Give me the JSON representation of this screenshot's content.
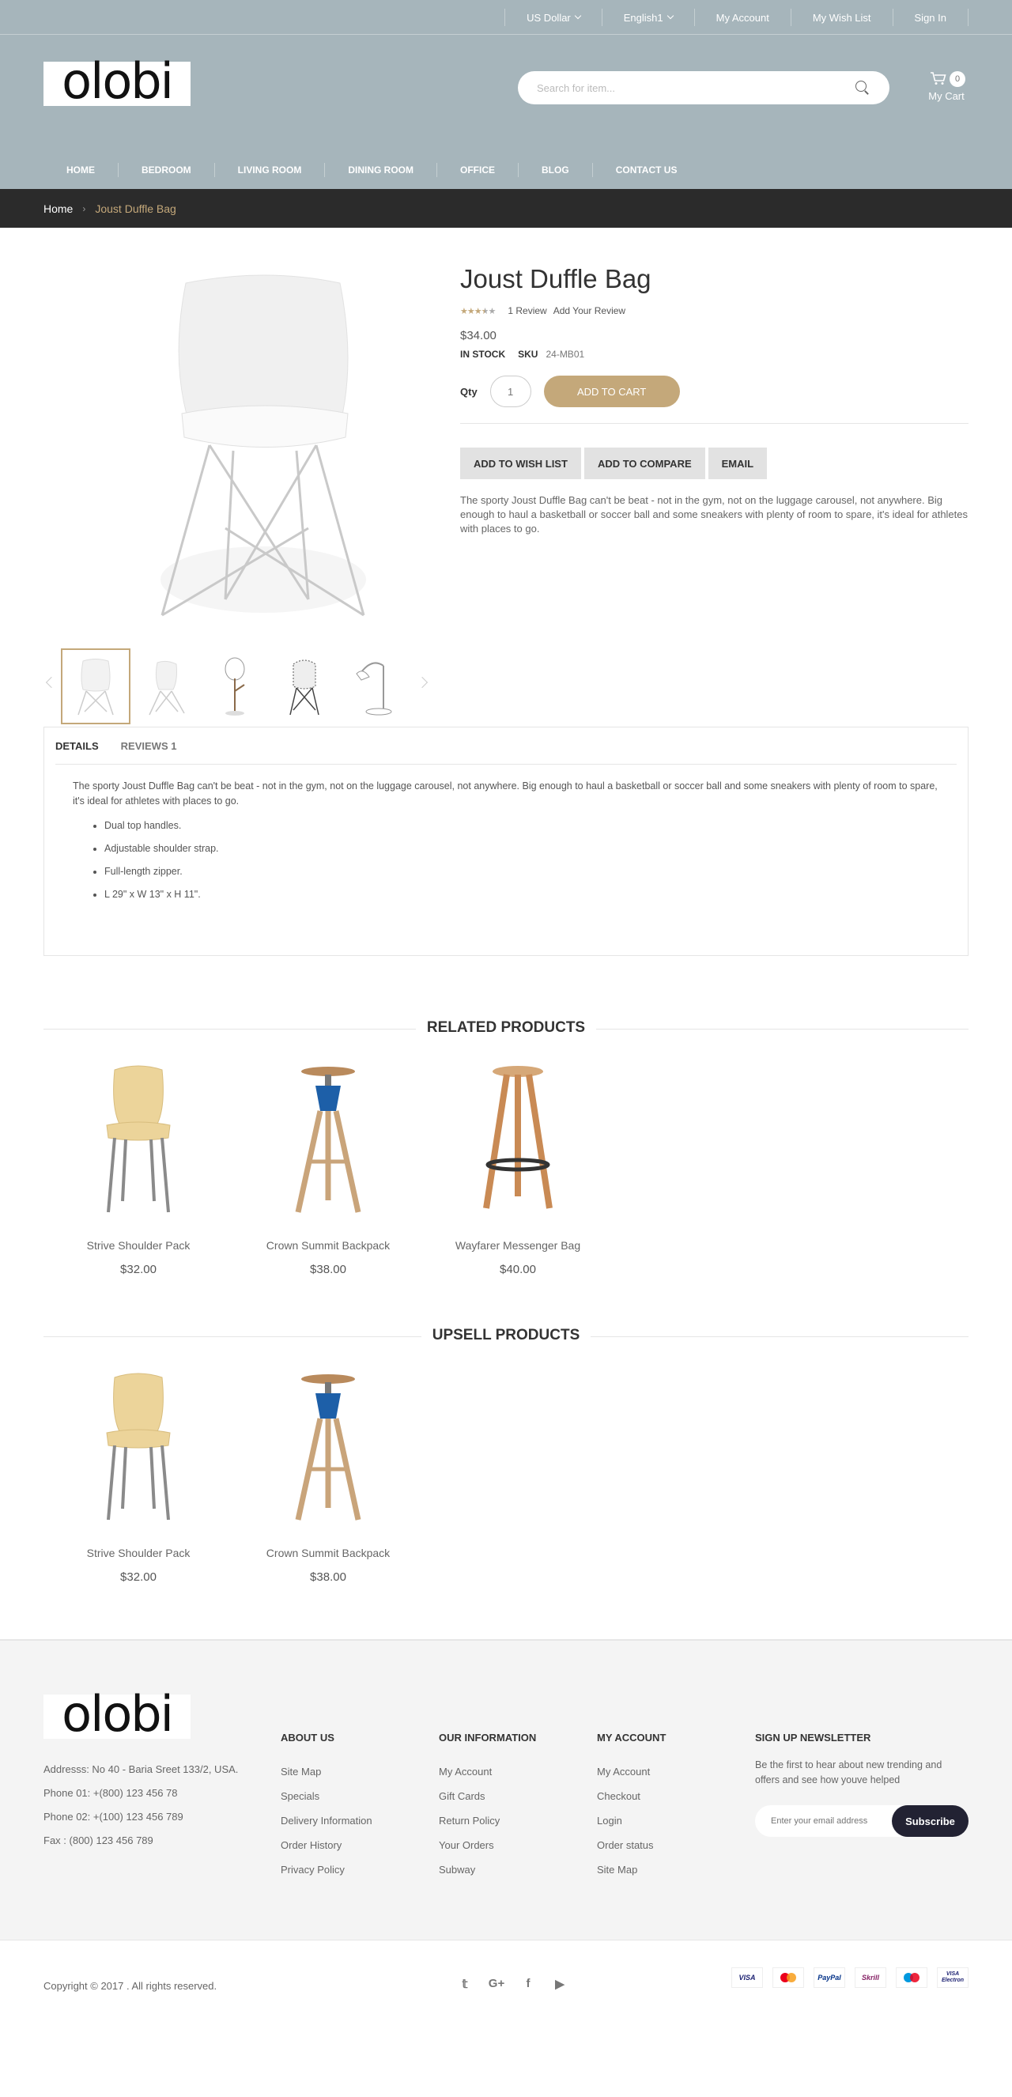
{
  "topbar": {
    "currency": "US Dollar",
    "language": "English1",
    "my_account": "My Account",
    "wish_list": "My Wish List",
    "sign_in": "Sign In"
  },
  "brand": {
    "logo_text": "olobi"
  },
  "search": {
    "placeholder": "Search for item..."
  },
  "cart": {
    "count": "0",
    "label": "My Cart"
  },
  "nav": [
    "Home",
    "Bedroom",
    "Living Room",
    "Dining Room",
    "Office",
    "Blog",
    "Contact Us"
  ],
  "breadcrumb": {
    "home": "Home",
    "separator": "›",
    "current": "Joust Duffle Bag"
  },
  "product": {
    "title": "Joust Duffle Bag",
    "rating_out_of_5": 3.5,
    "reviews": "1 Review",
    "add_review": "Add Your Review",
    "price": "$34.00",
    "stock": "IN STOCK",
    "sku_label": "SKU",
    "sku": "24-MB01",
    "qty_label": "Qty",
    "qty": "1",
    "add_to_cart": "ADD TO CART",
    "wish_list": "ADD TO WISH LIST",
    "compare": "ADD TO COMPARE",
    "email": "EMAIL",
    "short_description": "The sporty Joust Duffle Bag can't be beat - not in the gym, not on the luggage carousel, not anywhere. Big enough to haul a basketball or soccer ball and some sneakers with plenty of room to spare, it's ideal for athletes with places to go."
  },
  "tabs": {
    "details": "DETAILS",
    "reviews": "REVIEWS 1",
    "description": "The sporty Joust Duffle Bag can't be beat - not in the gym, not on the luggage carousel, not anywhere. Big enough to haul a basketball or soccer ball and some sneakers with plenty of room to spare, it's ideal for athletes with places to go.",
    "features": [
      "Dual top handles.",
      "Adjustable shoulder strap.",
      "Full-length zipper.",
      "L 29\" x W 13\" x H 11\"."
    ]
  },
  "related": {
    "title": "RELATED PRODUCTS",
    "items": [
      {
        "name": "Strive Shoulder Pack",
        "price": "$32.00",
        "image": "wood-chair"
      },
      {
        "name": "Crown Summit Backpack",
        "price": "$38.00",
        "image": "blue-stool"
      },
      {
        "name": "Wayfarer Messenger Bag",
        "price": "$40.00",
        "image": "wood-stool"
      }
    ]
  },
  "upsell": {
    "title": "UPSELL PRODUCTS",
    "items": [
      {
        "name": "Strive Shoulder Pack",
        "price": "$32.00",
        "image": "wood-chair"
      },
      {
        "name": "Crown Summit Backpack",
        "price": "$38.00",
        "image": "blue-stool"
      }
    ]
  },
  "footer": {
    "address": "Addresss: No 40 - Baria Sreet 133/2, USA.",
    "phone1": "Phone 01: +(800) 123 456 78",
    "phone2": "Phone 02: +(100) 123 456 789",
    "fax": "Fax : (800) 123 456 789",
    "about": {
      "title": "ABOUT US",
      "links": [
        "Site Map",
        "Specials",
        "Delivery Information",
        "Order History",
        "Privacy Policy"
      ]
    },
    "info": {
      "title": "OUR INFORMATION",
      "links": [
        "My Account",
        "Gift Cards",
        "Return Policy",
        "Your Orders",
        "Subway"
      ]
    },
    "account": {
      "title": "MY ACCOUNT",
      "links": [
        "My Account",
        "Checkout",
        "Login",
        "Order status",
        "Site Map"
      ]
    },
    "newsletter": {
      "title": "SIGN UP NEWSLETTER",
      "text": "Be the first to hear about new trending and offers and see how youve helped",
      "placeholder": "Enter your email address",
      "button": "Subscribe"
    },
    "copyright": "Copyright © 2017 . All rights reserved.",
    "social": [
      "twitter-icon",
      "google-plus-icon",
      "facebook-icon",
      "youtube-icon"
    ],
    "payments": [
      {
        "label": "VISA",
        "color": "#1a1f71"
      },
      {
        "label": "MC",
        "color": "#eb001b"
      },
      {
        "label": "PayPal",
        "color": "#003087"
      },
      {
        "label": "Skrill",
        "color": "#862165"
      },
      {
        "label": "Maestro",
        "color": "#0099df"
      },
      {
        "label": "VISA Electron",
        "color": "#1a1f71"
      }
    ]
  },
  "colors": {
    "header_bg": "#a6b5bb",
    "accent": "#c4a87a",
    "breadcrumb_bg": "#2b2b2b",
    "footer_bg": "#f4f4f4"
  }
}
